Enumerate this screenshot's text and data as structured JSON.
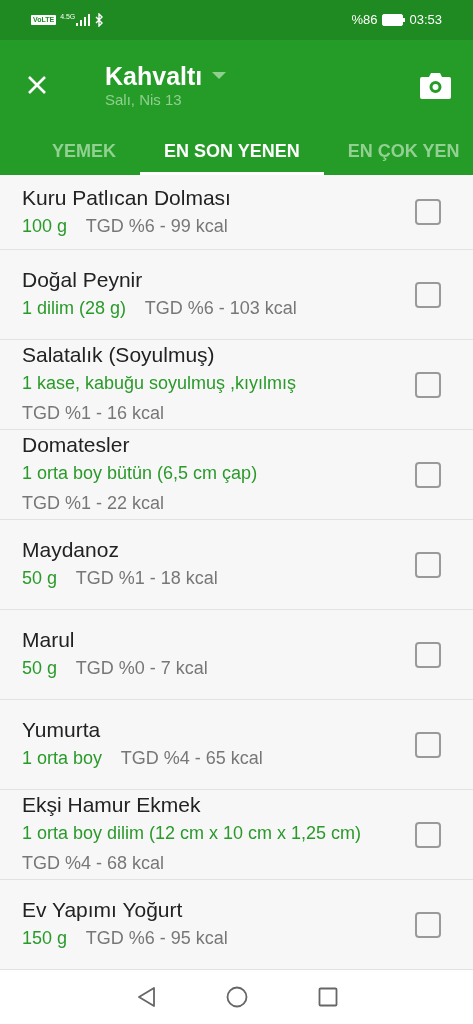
{
  "status_bar": {
    "network_badge": "VoLTE",
    "network_type": "4.5G",
    "battery": "%86",
    "time": "03:53"
  },
  "header": {
    "title": "Kahvaltı",
    "subtitle": "Salı, Nis 13"
  },
  "tabs": [
    {
      "label": "YEMEK",
      "selected": false
    },
    {
      "label": "EN SON YENEN",
      "selected": true
    },
    {
      "label": "EN ÇOK YEN",
      "selected": false
    }
  ],
  "foods": [
    {
      "name": "Kuru Patlıcan Dolması",
      "serving": "100  g",
      "info": "TGD %6 - 99 kcal",
      "checked": false
    },
    {
      "name": "Doğal Peynir",
      "serving": "1 dilim (28 g)",
      "info": "TGD %6 - 103 kcal",
      "checked": false
    },
    {
      "name": "Salatalık (Soyulmuş)",
      "serving": "1 kase, kabuğu soyulmuş ,kıyılmış",
      "info": "TGD %1 - 16 kcal",
      "checked": false
    },
    {
      "name": "Domatesler",
      "serving": "1 orta boy bütün (6,5 cm çap)",
      "info": "TGD %1 - 22 kcal",
      "checked": false
    },
    {
      "name": "Maydanoz",
      "serving": "50 g",
      "info": "TGD %1 - 18 kcal",
      "checked": false
    },
    {
      "name": "Marul",
      "serving": "50 g",
      "info": "TGD %0 - 7 kcal",
      "checked": false
    },
    {
      "name": "Yumurta",
      "serving": "1 orta boy",
      "info": "TGD %4 - 65 kcal",
      "checked": false
    },
    {
      "name": "Ekşi Hamur Ekmek",
      "serving": "1 orta boy dilim (12 cm x 10 cm x 1,25 cm)",
      "info": "TGD %4 - 68 kcal",
      "checked": false
    },
    {
      "name": "Ev Yapımı Yoğurt",
      "serving": "150 g",
      "info": "TGD %6 - 95 kcal",
      "checked": false
    }
  ]
}
